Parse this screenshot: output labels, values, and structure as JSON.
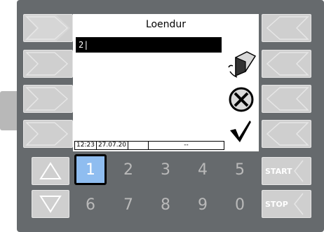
{
  "screen": {
    "title": "Loendur",
    "input_value": "2|"
  },
  "status": {
    "time": "12:23",
    "date": "27.07.20",
    "field3": "",
    "field4": "--"
  },
  "keypad": {
    "row1": [
      "1",
      "2",
      "3",
      "4",
      "5"
    ],
    "row2": [
      "6",
      "7",
      "8",
      "9",
      "0"
    ]
  },
  "buttons": {
    "start": "START",
    "stop": "STOP"
  },
  "icons": {
    "eraser": "eraser-icon",
    "cancel": "cancel-icon",
    "confirm": "checkmark-icon",
    "up": "up-arrow-icon",
    "down": "down-arrow-icon"
  },
  "colors": {
    "bezel": "#666a6d",
    "selected_key": "#8fbdf0"
  }
}
